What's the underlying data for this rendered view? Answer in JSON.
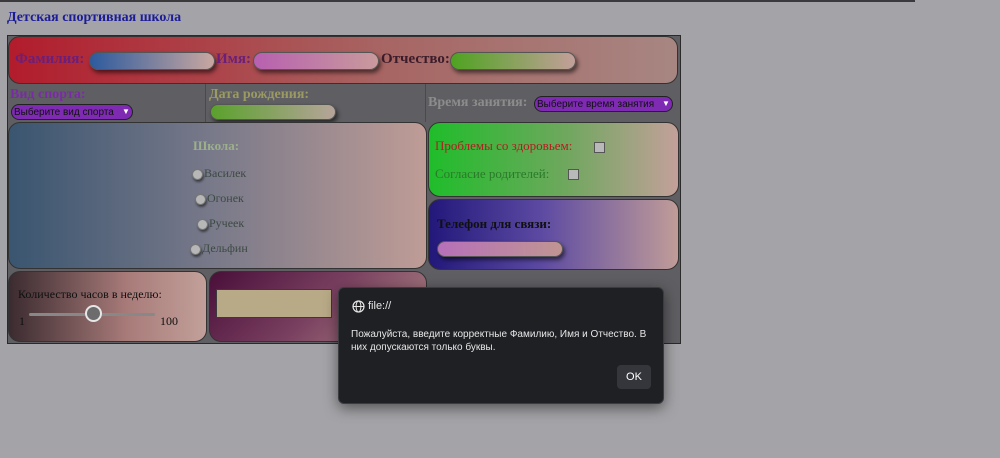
{
  "page": {
    "title": "Детская спортивная школа"
  },
  "name_row": {
    "surname_label": "Фамилия:",
    "name_label": "Имя:",
    "patronymic_label": "Отчество:"
  },
  "sport": {
    "label": "Вид спорта:",
    "selected": "Выберите вид спорта"
  },
  "birth": {
    "label": "Дата рождения:"
  },
  "time": {
    "label": "Время занятия:",
    "selected": "Выберите время занятия"
  },
  "school": {
    "label": "Школа:",
    "options": [
      "Василек",
      "Огонек",
      "Ручеек",
      "Дельфин"
    ]
  },
  "health": {
    "problems_label": "Проблемы со здоровьем:",
    "second_label": "Согласие родителей:"
  },
  "phone": {
    "label": "Телефон для связи:"
  },
  "hours": {
    "label": "Количество часов в неделю:",
    "min": "1",
    "max": "100",
    "value_fraction": 0.5
  },
  "dialog": {
    "origin": "file://",
    "message": "Пожалуйста, введите корректные Фамилию, Имя и Отчество. В них допускаются только буквы.",
    "ok_label": "OK"
  },
  "colors": {
    "overlay": "#a4a4a8",
    "dialog_bg": "#1f2024",
    "title": "#1c1c9a"
  },
  "icons": {
    "globe": "globe-icon",
    "chevron": "chevron-down-icon"
  }
}
